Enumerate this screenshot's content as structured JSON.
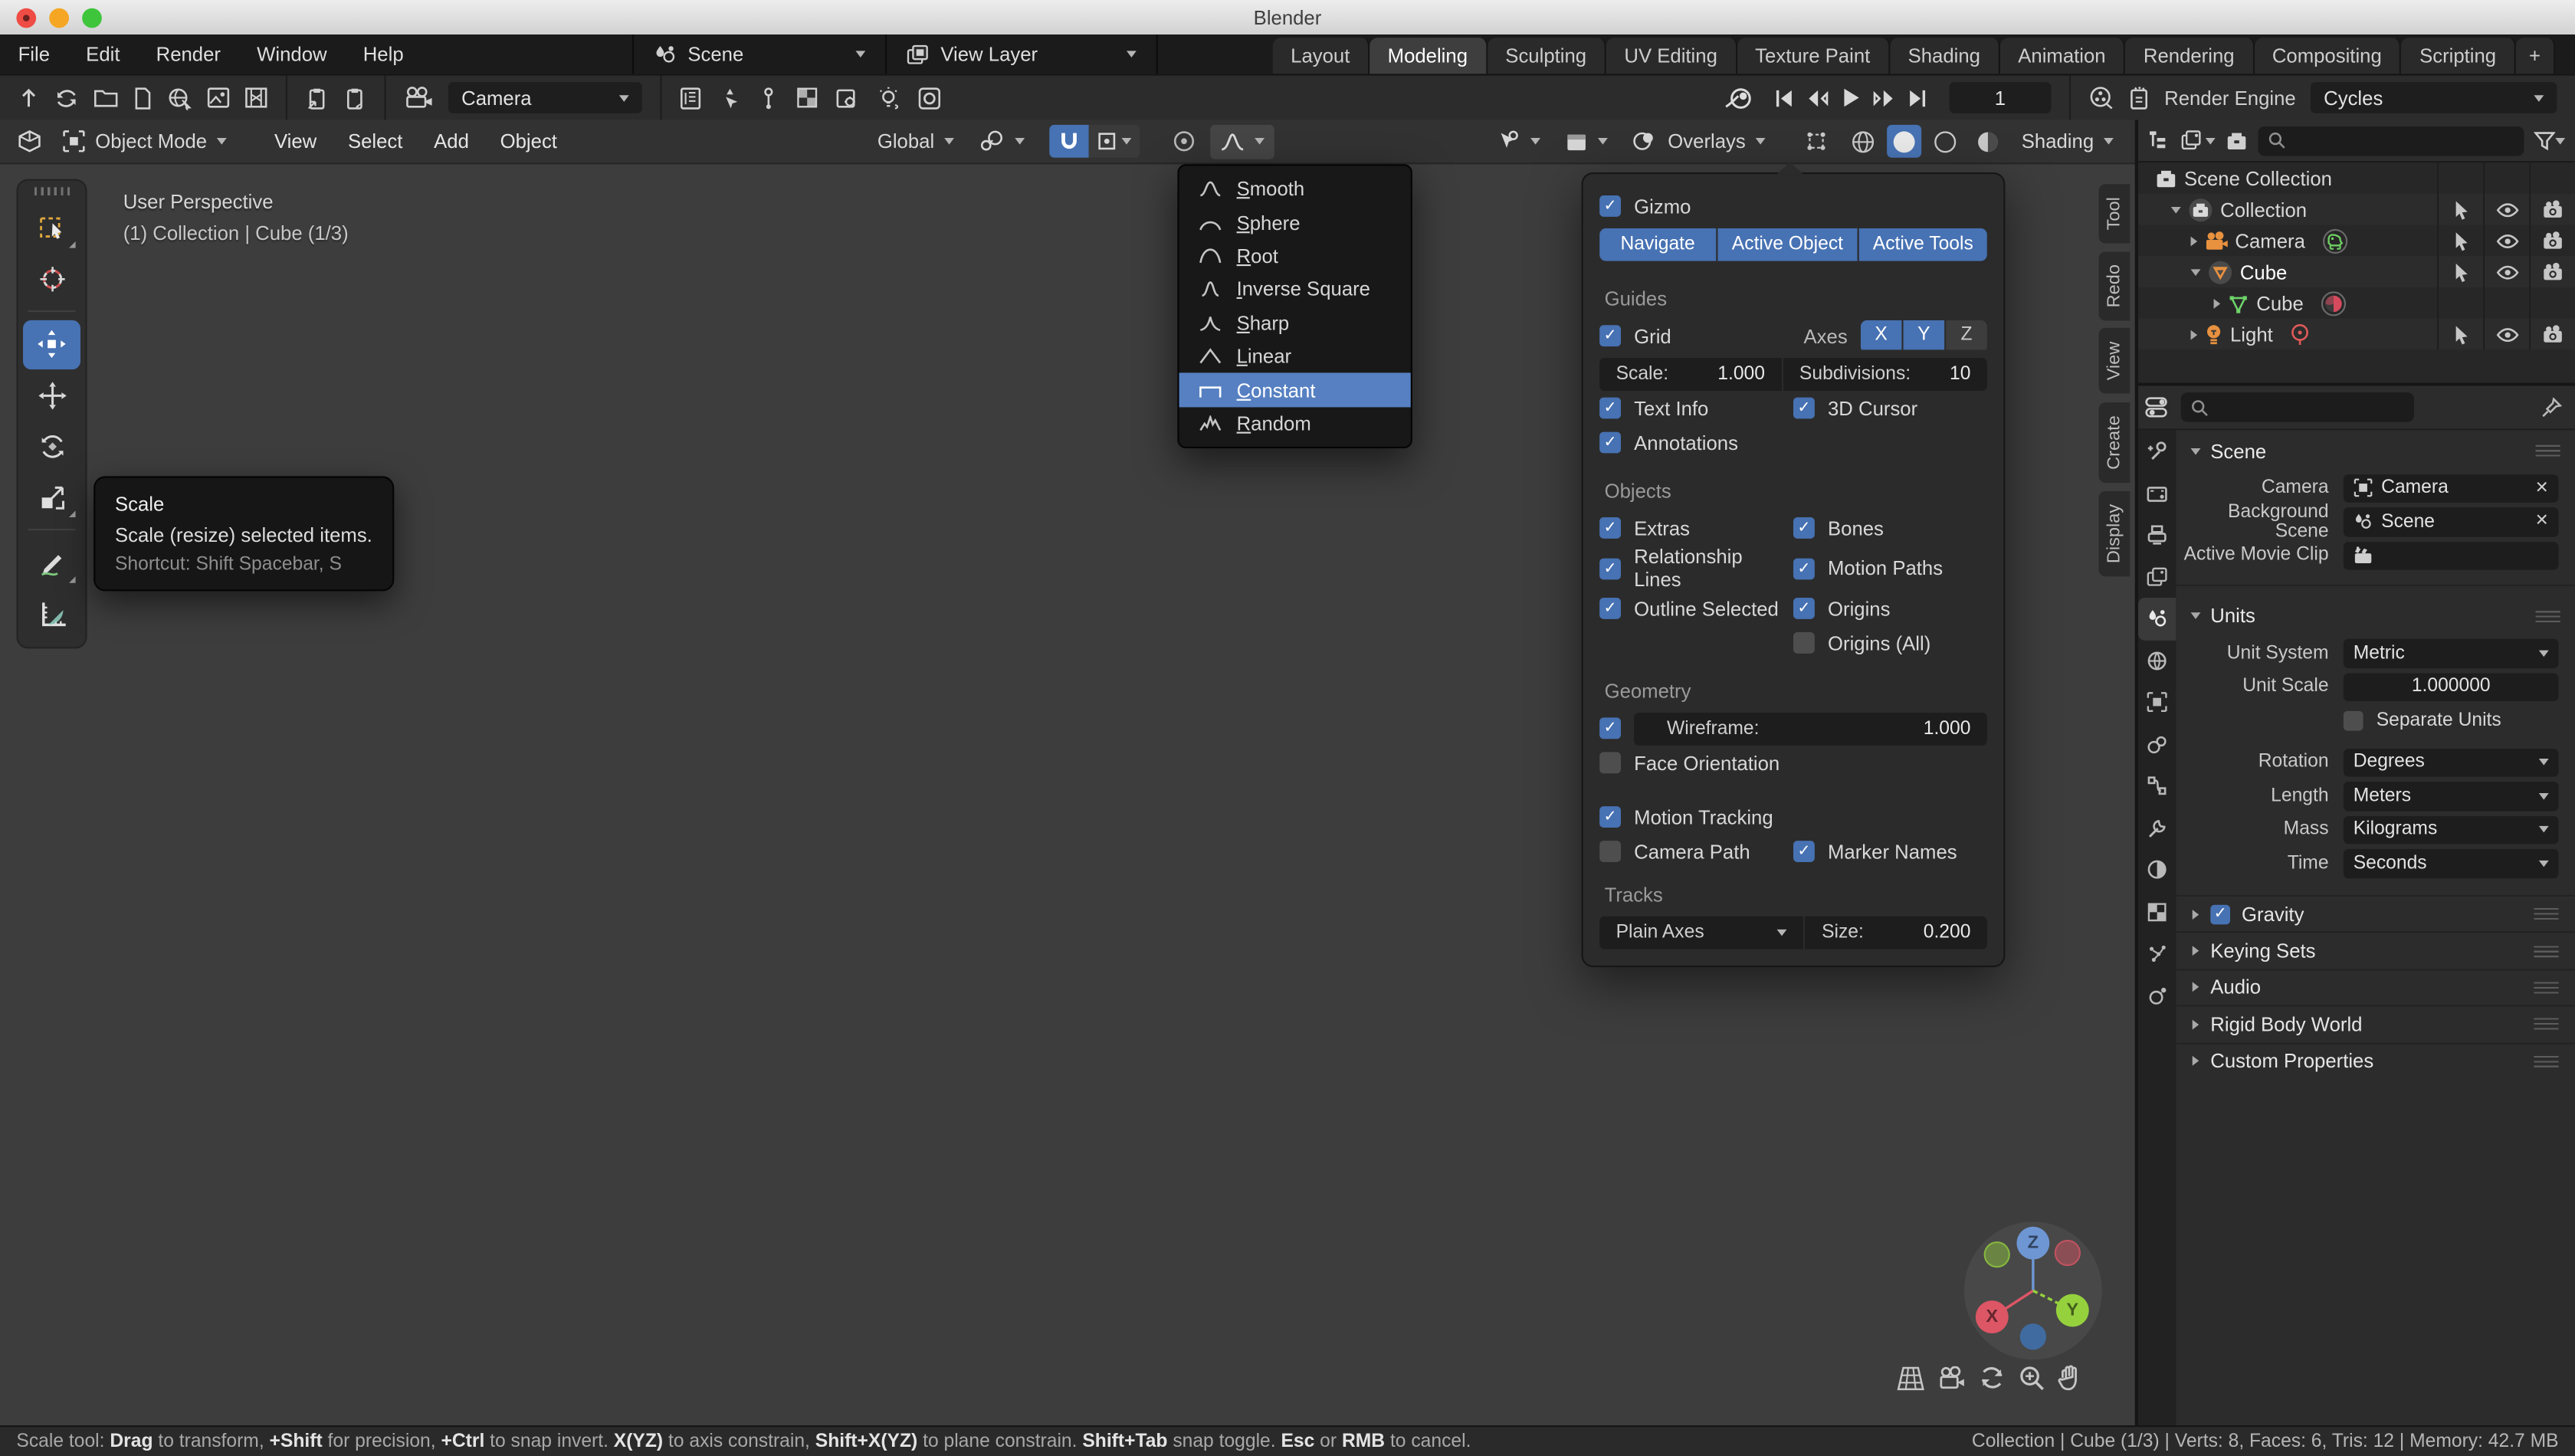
{
  "window": {
    "title": "Blender"
  },
  "menubar": {
    "menus": [
      "File",
      "Edit",
      "Render",
      "Window",
      "Help"
    ],
    "scene_selector": "Scene",
    "view_layer_selector": "View Layer",
    "workspace_tabs": [
      "Layout",
      "Modeling",
      "Sculpting",
      "UV Editing",
      "Texture Paint",
      "Shading",
      "Animation",
      "Rendering",
      "Compositing",
      "Scripting"
    ],
    "active_tab": "Modeling",
    "new_workspace": "+"
  },
  "topbar": {
    "camera": "Camera",
    "frame": "1",
    "render_engine_label": "Render Engine",
    "render_engine": "Cycles"
  },
  "viewport_header": {
    "mode": "Object Mode",
    "menus": [
      "View",
      "Select",
      "Add",
      "Object"
    ],
    "orientation": "Global",
    "overlays": "Overlays",
    "shading": "Shading"
  },
  "viewport": {
    "view_label": "User Perspective",
    "context_label": "(1) Collection | Cube (1/3)"
  },
  "toolbar_tooltip": {
    "title": "Scale",
    "description": "Scale (resize) selected items.",
    "shortcut": "Shortcut: Shift Spacebar, S"
  },
  "falloff_menu": {
    "items": [
      "Smooth",
      "Sphere",
      "Root",
      "Inverse Square",
      "Sharp",
      "Linear",
      "Constant",
      "Random"
    ],
    "selected": "Constant"
  },
  "overlays_panel": {
    "gizmo": "Gizmo",
    "gizmo_buttons": [
      "Navigate",
      "Active Object",
      "Active Tools"
    ],
    "guides": "Guides",
    "grid": "Grid",
    "axes_label": "Axes",
    "axes": [
      "X",
      "Y",
      "Z"
    ],
    "scale_label": "Scale:",
    "scale_value": "1.000",
    "subdivisions_label": "Subdivisions:",
    "subdivisions_value": "10",
    "text_info": "Text Info",
    "cursor_3d": "3D Cursor",
    "annotations": "Annotations",
    "objects": "Objects",
    "extras": "Extras",
    "bones": "Bones",
    "relationship_lines": "Relationship Lines",
    "motion_paths": "Motion Paths",
    "outline_selected": "Outline Selected",
    "origins": "Origins",
    "origins_all": "Origins (All)",
    "geometry": "Geometry",
    "wireframe_label": "Wireframe:",
    "wireframe_value": "1.000",
    "face_orientation": "Face Orientation",
    "motion_tracking": "Motion Tracking",
    "camera_path": "Camera Path",
    "marker_names": "Marker Names",
    "tracks": "Tracks",
    "tracks_type": "Plain Axes",
    "size_label": "Size:",
    "size_value": "0.200"
  },
  "sidebar_tabs": [
    "Tool",
    "Redo",
    "View",
    "Create",
    "Display"
  ],
  "outliner": {
    "rows": [
      {
        "label": "Scene Collection"
      },
      {
        "label": "Collection"
      },
      {
        "label": "Camera"
      },
      {
        "label": "Cube"
      },
      {
        "label": "Cube"
      },
      {
        "label": "Light"
      }
    ]
  },
  "properties": {
    "scene_panel": "Scene",
    "camera_label": "Camera",
    "camera_value": "Camera",
    "background_scene_label": "Background Scene",
    "background_scene_value": "Scene",
    "movie_clip_label": "Active Movie Clip",
    "units_panel": "Units",
    "unit_system_label": "Unit System",
    "unit_system": "Metric",
    "unit_scale_label": "Unit Scale",
    "unit_scale": "1.000000",
    "separate_units": "Separate Units",
    "rotation_label": "Rotation",
    "rotation": "Degrees",
    "length_label": "Length",
    "length": "Meters",
    "mass_label": "Mass",
    "mass": "Kilograms",
    "time_label": "Time",
    "time": "Seconds",
    "collapsed_panels": [
      "Gravity",
      "Keying Sets",
      "Audio",
      "Rigid Body World",
      "Custom Properties"
    ]
  },
  "nav_gizmo": {
    "x": "X",
    "y": "Y",
    "z": "Z"
  },
  "statusbar": {
    "left": [
      "Scale tool: ",
      "Drag",
      " to transform, ",
      "+Shift",
      " for precision, ",
      "+Ctrl",
      " to snap invert. ",
      "X(YZ)",
      " to axis constrain, ",
      "Shift+X(YZ)",
      " to plane constrain. ",
      "Shift+Tab",
      " snap toggle. ",
      "Esc",
      " or ",
      "RMB",
      " to cancel."
    ],
    "right": "Collection | Cube (1/3) | Verts: 8, Faces: 6, Tris: 12 | Memory: 42.7 MB"
  },
  "colors": {
    "accent": "#4772b3",
    "menu_selection": "#5680c2",
    "axis_x": "#dd5666",
    "axis_y": "#95d13d",
    "axis_z": "#6d96d3",
    "object_orange": "#e8913f",
    "data_green": "#6ed36a"
  }
}
